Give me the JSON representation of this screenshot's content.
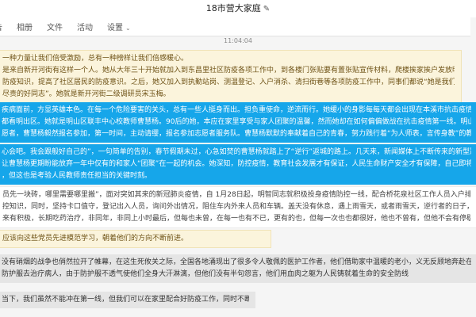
{
  "window": {
    "title": "18市营大家庭"
  },
  "tabs": [
    {
      "label": "告"
    },
    {
      "label": "相册"
    },
    {
      "label": "文件"
    },
    {
      "label": "活动"
    },
    {
      "label": "设置"
    }
  ],
  "chat": {
    "timestamp": "11:04:04",
    "messages": [
      {
        "style": "beige",
        "lines": [
          "一种力量让我们倍受激励，总有一种榜样让我们倍感暖心。",
          "是来自新开河街有这样一个人。她从大年三十开始就加入到东昌里社区防疫各项工作中，到各楼门张贴要有置张贴宣传材料，爬楼挨家挨户发放明白纸。在疫情防控初期，有效地宣传了",
          "防疫知识，提高了社区居民的防疫意识。之后，她又加入到执勤站岗、测温登记、入户消杀、清扫街巷等各项防疫工作中，同事们都说“她是我们的榜样”。居民们都说“这可是一位",
          "尽责的好同志”。她就是新开河街二级调研员宋玉梅。"
        ]
      },
      {
        "style": "blue",
        "lines": [
          "疾病面前，方显英雄本色。在每一个危险要害的关头，总有一些人挺身而出。担负重使命，逆流而行。她缓小的身影每每天都会出现在本溪市抗击疫情的第一线，一同随着全市的党员干部",
          "都看明出区。她就是明山区联丰中心校教师曹慧杨。90后的她，本应在家里享受与家人团聚的温馨，然而她却在如何偏偏做战在抗击疫情第一线。明山区文明办面向广大市民招募抗击疫情",
          "愿者，曹慧杨毅然报名参加，第一时间，主动请缨，报名参加志愿者服务队。曹慧杨默默的奉献着自己的青春，努力践行着“为人师表，言传身教”的教师使命誓言。"
        ]
      },
      {
        "style": "blue",
        "lines": [
          "心会吧。我会跟般好自己的”，一句简单的告别，春节假期未过，心急如焚的曹慧杨就踏上了“逆行”返城的路上。几天来，新闻媒体上不断传来的新型冠状病毒感染的肺炎疫情的消",
          "让曹慧杨更期盼能放弃一年中仅有的和家人“团聚”在一起的机会。她深知，防控疫情，教育社会发展才有保证，人民生命财产安全才有保障，自己即将迎来的防控工作任务更一定会很",
          "，但这也是考验人民教师责任担当的关键时刻。"
        ]
      },
      {
        "style": "white",
        "lines": [
          "员先一块砖，哪里需要哪里搬”，面对突如其来的新冠肺炎疫情，自 1月28日起，明智同志就积极投身疫情防控一线，配合桥花泉社区工作人员入户排查“四类人员”，测量体温和科",
          "控知识，同时，坚持卡口值守，登记出入人员，询问外出情况，阻住车内外来人员和车辆。盖天没有休息，遇上雨雪天，或者雨雪天，逆行者的日子，往往冻得手脚冰冷、脸色铁青，他的脚不",
          "来有积极，长期吃药治疗，非同年，非同上小时最后，但每也未曾，在每一也有不已，更有的也，但每一次也也都很好，他也不曾有，但他不会有停歇，不曾离开。"
        ]
      },
      {
        "style": "beige",
        "lines": [
          "应该向这些党员先进模范学习，朝着他们的方向不断前进。"
        ]
      },
      {
        "style": "gray",
        "lines": [
          "没有硝烟的战争也俏然拉开了帷幕，在这生死攸关之际，全国各地涌现出了很多令人敬佩的医护工作者，他们借助家中温暖的老小，义无反顾地奔赴在抗疫第一线。他们，每天穿着厚",
          "防护服去治疗病人，由于防护服不透气使他们全身大汗淋漓，但他们没有半句怨言，他们用血肉之躯为人民铸就着生命的安全防线"
        ]
      },
      {
        "style": "gray",
        "lines": [
          "当下，我们虽然不能冲在第一线，但我们可以在家里配合好防疫工作，同时不断提升自己"
        ]
      }
    ]
  },
  "icons": {
    "edit": "pencil-icon",
    "settings_dropdown": "chevron-down-icon"
  },
  "colors": {
    "highlight_blue": "#16a6ea",
    "beige": "#fbf4dc",
    "gray": "#e5e5e5"
  }
}
